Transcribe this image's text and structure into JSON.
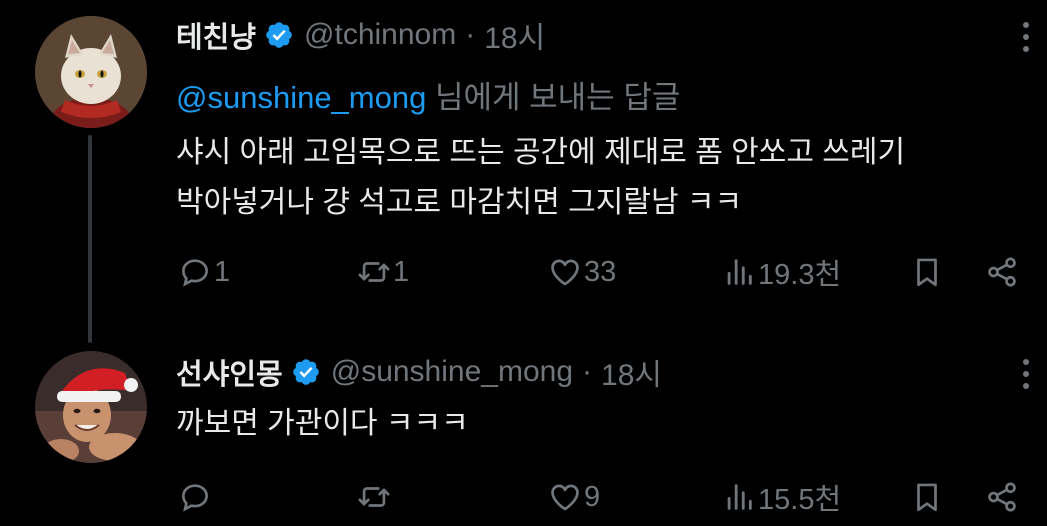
{
  "tweets": [
    {
      "display_name": "테친냥",
      "handle": "@tchinnom",
      "separator": "·",
      "time": "18시",
      "reply_prefix": "@sunshine_mong",
      "reply_suffix": " 님에게 보내는 답글",
      "text_lines": [
        "샤시 아래 고임목으로 뜨는 공간에 제대로 폼 안쏘고 쓰레기",
        "박아넣거나 걍 석고로 마감치면 그지랄남 ㅋㅋ"
      ],
      "actions": {
        "reply": "1",
        "retweet": "1",
        "like": "33",
        "views": "19.3천"
      }
    },
    {
      "display_name": "선샤인몽",
      "handle": "@sunshine_mong",
      "separator": "·",
      "time": "18시",
      "text_lines": [
        "까보면 가관이다 ㅋㅋㅋ"
      ],
      "actions": {
        "reply": "",
        "retweet": "",
        "like": "9",
        "views": "15.5천"
      }
    }
  ],
  "colors": {
    "background": "#000000",
    "text_primary": "#e7e9ea",
    "text_secondary": "#71767b",
    "link": "#1d9bf0",
    "verified": "#1d9bf0",
    "thread_line": "#333639"
  },
  "icons": [
    "verified-badge-icon",
    "more-icon",
    "reply-icon",
    "retweet-icon",
    "like-icon",
    "views-icon",
    "bookmark-icon",
    "share-icon"
  ]
}
